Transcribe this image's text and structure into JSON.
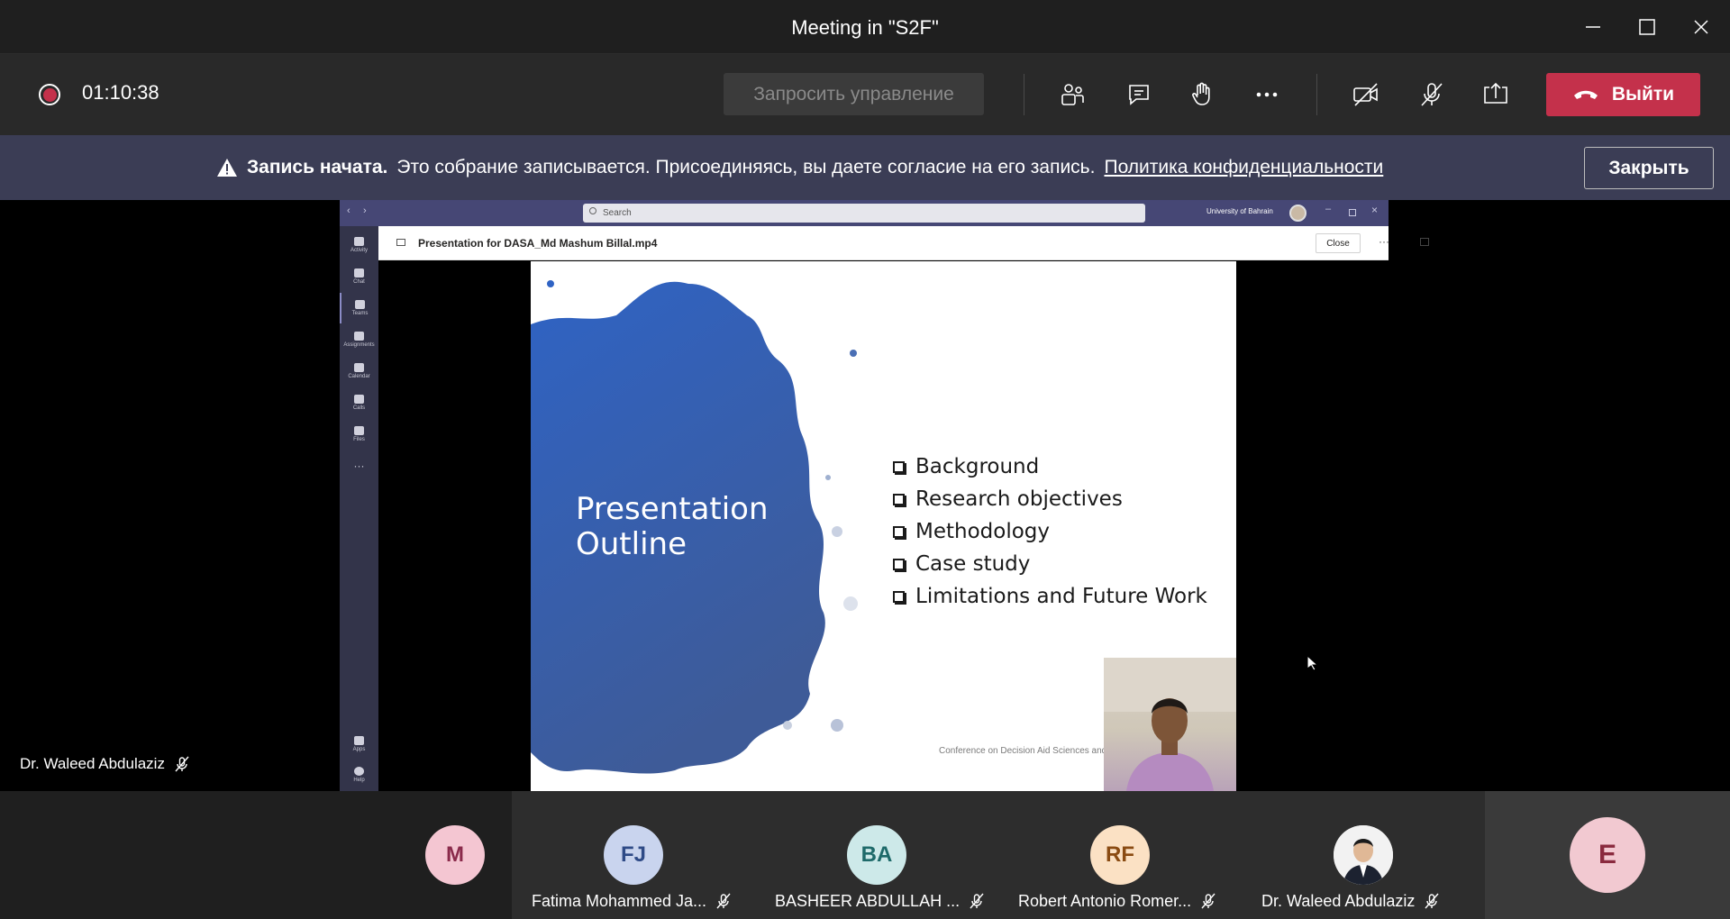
{
  "window": {
    "title": "Meeting in \"S2F\""
  },
  "toolbar": {
    "recording_timer": "01:10:38",
    "request_control_label": "Запросить управление",
    "leave_label": "Выйти",
    "icons": [
      "participants-icon",
      "chat-icon",
      "raise-hand-icon",
      "more-icon",
      "camera-off-icon",
      "mic-off-icon",
      "share-icon",
      "phone-hangup-icon"
    ]
  },
  "banner": {
    "bold": "Запись начата.",
    "text": "Это собрание записывается. Присоединяясь, вы даете согласие на его запись.",
    "link": "Политика конфиденциальности",
    "close_label": "Закрыть"
  },
  "shared_screen": {
    "search_placeholder": "Search",
    "org_name": "University of Bahrain",
    "file_name": "Presentation for DASA_Md Mashum Billal.mp4",
    "close_label": "Close",
    "rail": [
      {
        "label": "Activity"
      },
      {
        "label": "Chat"
      },
      {
        "label": "Teams"
      },
      {
        "label": "Assignments"
      },
      {
        "label": "Calendar"
      },
      {
        "label": "Calls"
      },
      {
        "label": "Files"
      },
      {
        "label": "Apps"
      },
      {
        "label": "Help"
      }
    ],
    "slide": {
      "title_line1": "Presentation",
      "title_line2": "Outline",
      "items": [
        "Background",
        "Research objectives",
        "Methodology",
        "Case study",
        "Limitations and Future Work"
      ],
      "footer": "Conference on Decision Aid Sciences and A"
    }
  },
  "active_speaker": {
    "name": "Dr. Waleed Abdulaziz"
  },
  "participants": [
    {
      "initials": "M",
      "name": "",
      "bg": "#f4c6d2",
      "fg": "#8a2a4b"
    },
    {
      "initials": "FJ",
      "name": "Fatima Mohammed Ja...",
      "bg": "#c9d4ee",
      "fg": "#2e4a86"
    },
    {
      "initials": "BA",
      "name": "BASHEER ABDULLAH ...",
      "bg": "#cde9e9",
      "fg": "#1e6a6a"
    },
    {
      "initials": "RF",
      "name": "Robert Antonio Romer...",
      "bg": "#fbe1c4",
      "fg": "#8a4b12"
    },
    {
      "initials": "",
      "name": "Dr. Waleed Abdulaziz",
      "bg": "#e9e9e9",
      "fg": "#333333"
    },
    {
      "initials": "E",
      "name": "",
      "bg": "#f2c9d1",
      "fg": "#8a2a3e"
    }
  ]
}
